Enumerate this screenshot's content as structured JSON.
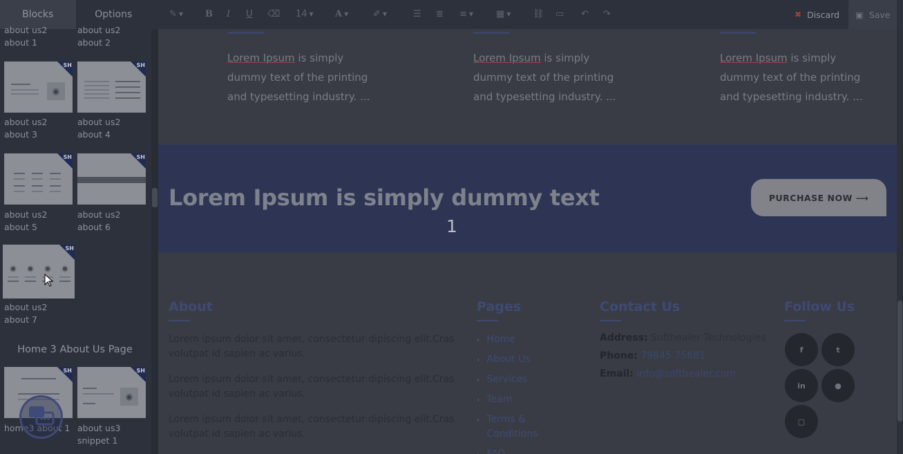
{
  "left_panel": {
    "tabs": [
      "Blocks",
      "Options"
    ],
    "snippets": [
      {
        "label": "about us2 about 1"
      },
      {
        "label": "about us2 about 2"
      },
      {
        "label": "about us2 about 3"
      },
      {
        "label": "about us2 about 4"
      },
      {
        "label": "about us2 about 5"
      },
      {
        "label": "about us2 about 6"
      },
      {
        "label": "about us2 about 7"
      }
    ],
    "badge": "SH",
    "section_title": "Home 3 About Us Page",
    "section_snippets": [
      {
        "label": "home3 about 1"
      },
      {
        "label": "about us3 snippet 1"
      }
    ]
  },
  "toolbar": {
    "font_size": "14",
    "discard_label": "Discard",
    "save_label": "Save",
    "icons": [
      "magic-wand-icon",
      "bold-icon",
      "italic-icon",
      "underline-icon",
      "eraser-icon",
      "font-size",
      "font-color-icon",
      "brush-icon",
      "unordered-list-icon",
      "ordered-list-icon",
      "align-icon",
      "table-icon",
      "link-icon",
      "image-icon",
      "undo-icon",
      "redo-icon"
    ]
  },
  "features": [
    {
      "link": "Lorem Ipsum",
      "text": " is simply dummy text of the printing and typesetting industry. ..."
    },
    {
      "link": "Lorem Ipsum",
      "text": " is simply dummy text of the printing and typesetting industry. ..."
    },
    {
      "link": "Lorem Ipsum",
      "text": " is simply dummy text of the printing and typesetting industry. ..."
    }
  ],
  "banner": {
    "title": "Lorem Ipsum is simply dummy text",
    "number": "1",
    "button": "PURCHASE NOW ⟶"
  },
  "footer": {
    "about": {
      "heading": "About",
      "paragraphs": [
        "Lorem ipsum dolor sit amet, consectetur dipiscing elit.Cras volutpat id sapien ac varius.",
        "Lorem ipsum dolor sit amet, consectetur dipiscing elit.Cras volutpat id sapien ac varius.",
        "Lorem ipsum dolor sit amet, consectetur dipiscing elit.Cras volutpat id sapien ac varius."
      ]
    },
    "pages": {
      "heading": "Pages",
      "items": [
        "Home",
        "About Us",
        "Services",
        "Team",
        "Terms & Conditions",
        "FAQ"
      ]
    },
    "contact": {
      "heading": "Contact Us",
      "address_label": "Address:",
      "address": "Softhealer Technologies",
      "phone_label": "Phone:",
      "phone": "79845 75681",
      "email_label": "Email:",
      "email": "info@softhealer.com"
    },
    "follow": {
      "heading": "Follow Us",
      "socials": [
        {
          "icon": "facebook-icon",
          "glyph": "f"
        },
        {
          "icon": "twitter-icon",
          "glyph": "t"
        },
        {
          "icon": "linkedin-icon",
          "glyph": "in"
        },
        {
          "icon": "github-icon",
          "glyph": "●"
        },
        {
          "icon": "instagram-icon",
          "glyph": "▢"
        }
      ]
    }
  }
}
